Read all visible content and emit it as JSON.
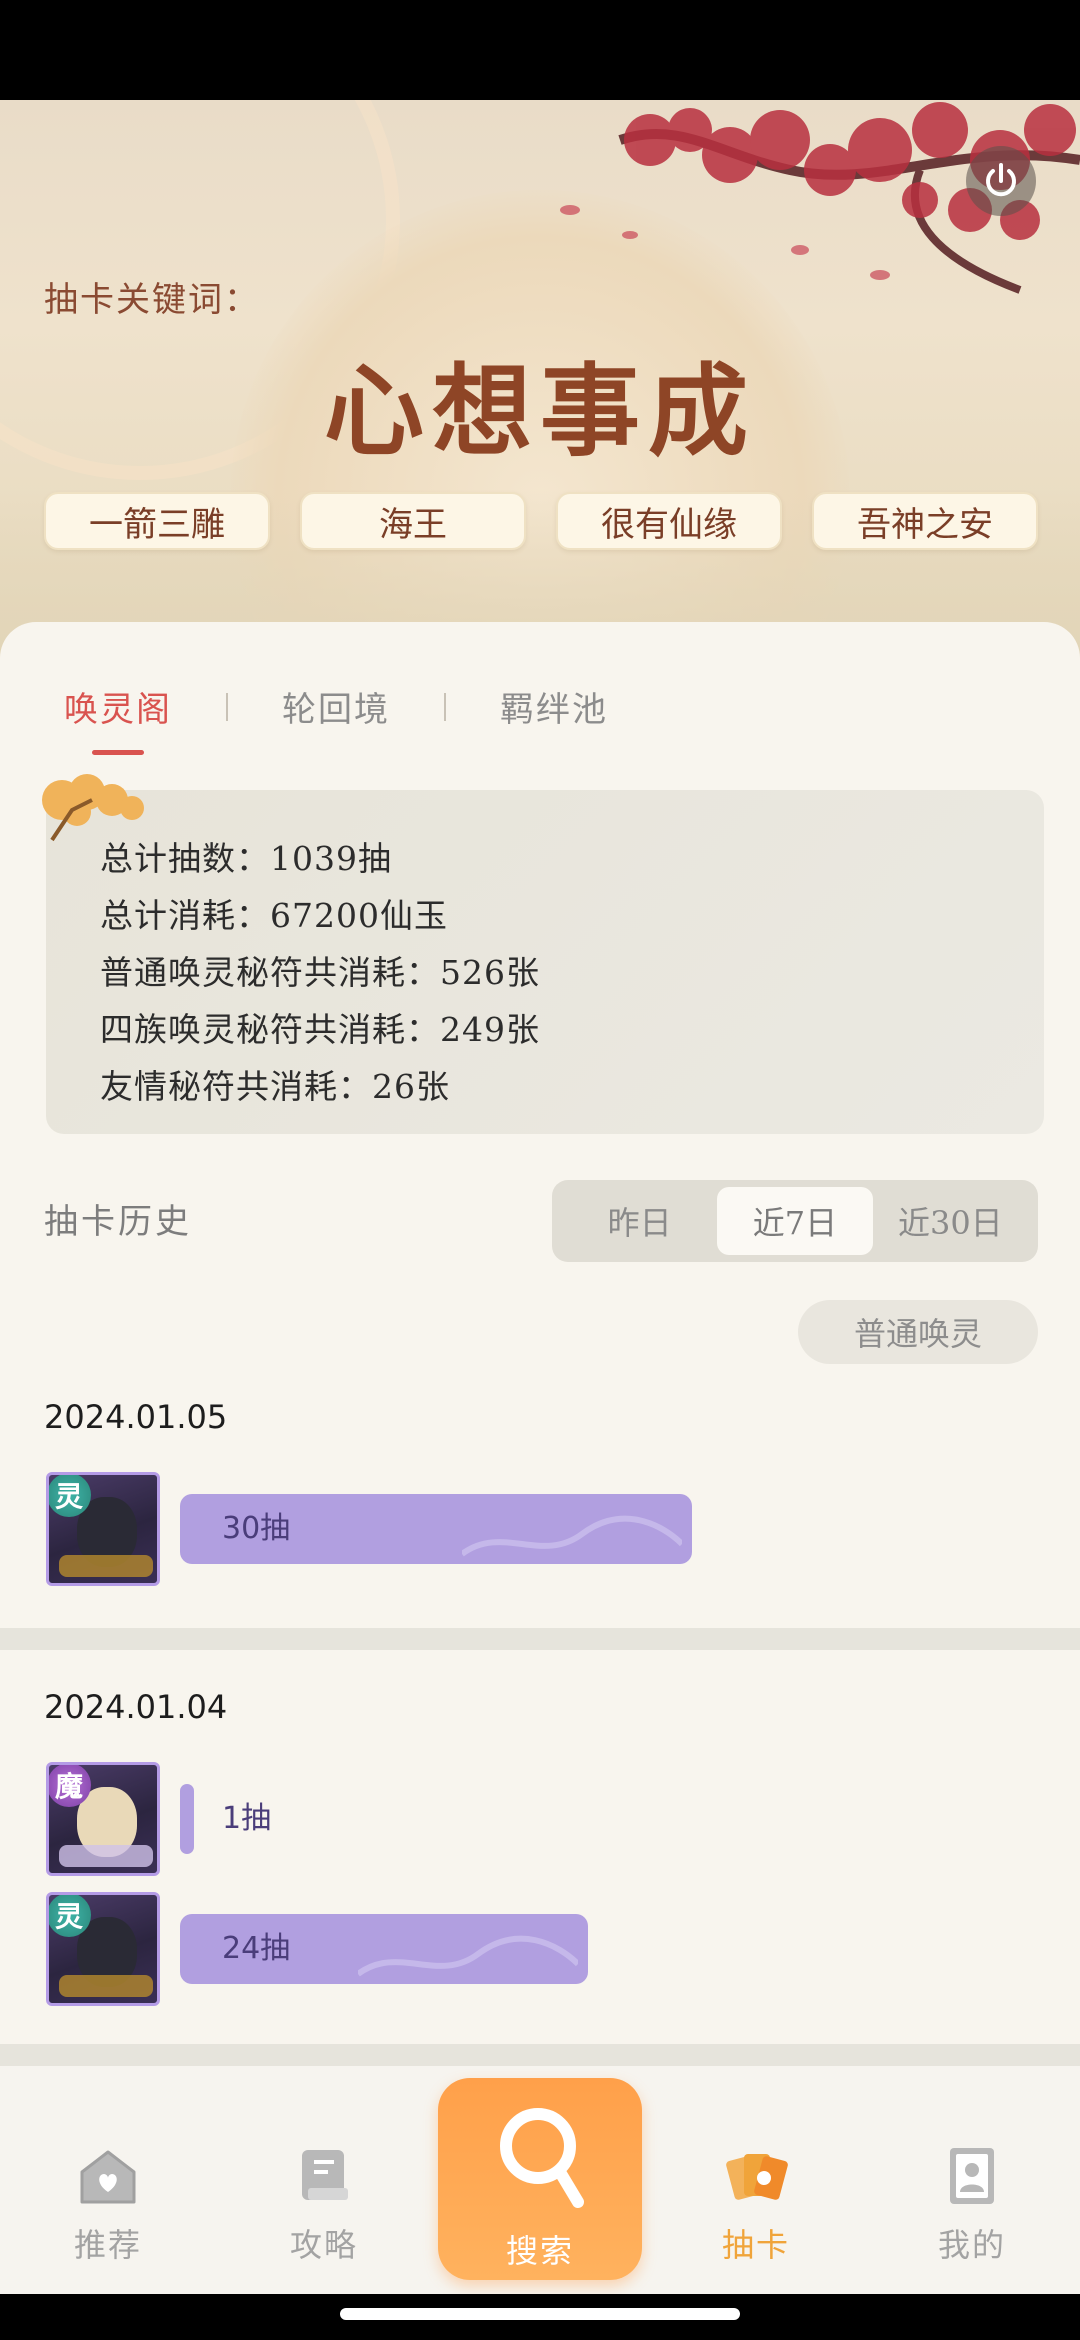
{
  "hero": {
    "keyword_label": "抽卡关键词：",
    "keyword_title": "心想事成",
    "tags": [
      "一箭三雕",
      "海王",
      "很有仙缘",
      "吾神之安"
    ]
  },
  "sub_tabs": [
    {
      "label": "唤灵阁",
      "active": true
    },
    {
      "label": "轮回境",
      "active": false
    },
    {
      "label": "羁绊池",
      "active": false
    }
  ],
  "stats": [
    "总计抽数：1039抽",
    "总计消耗：67200仙玉",
    "普通唤灵秘符共消耗：526张",
    "四族唤灵秘符共消耗：249张",
    "友情秘符共消耗：26张"
  ],
  "history": {
    "title": "抽卡历史",
    "ranges": [
      {
        "label": "昨日",
        "active": false
      },
      {
        "label": "近7日",
        "active": true
      },
      {
        "label": "近30日",
        "active": false
      }
    ],
    "filter": "普通唤灵",
    "groups": [
      {
        "date": "2024.01.05",
        "records": [
          {
            "badge": "灵",
            "avatar": "dark-hero",
            "count_label": "30抽",
            "bar_fraction": 0.64
          }
        ]
      },
      {
        "date": "2024.01.04",
        "records": [
          {
            "badge": "魔",
            "avatar": "blonde-hero",
            "count_label": "1抽",
            "bar_fraction": 0.016
          },
          {
            "badge": "灵",
            "avatar": "dark-hero",
            "count_label": "24抽",
            "bar_fraction": 0.51
          }
        ]
      }
    ]
  },
  "nav": {
    "items": [
      {
        "label": "推荐",
        "icon": "heart-house-icon"
      },
      {
        "label": "攻略",
        "icon": "book-icon"
      },
      {
        "label": "搜索",
        "icon": "search-icon"
      },
      {
        "label": "抽卡",
        "icon": "cards-icon",
        "active": true
      },
      {
        "label": "我的",
        "icon": "profile-card-icon"
      }
    ]
  },
  "colors": {
    "accent_red": "#d9534f",
    "bar_purple": "#b19fe0",
    "fab_orange": "#ffa04a",
    "active_nav": "#f0a43a"
  }
}
